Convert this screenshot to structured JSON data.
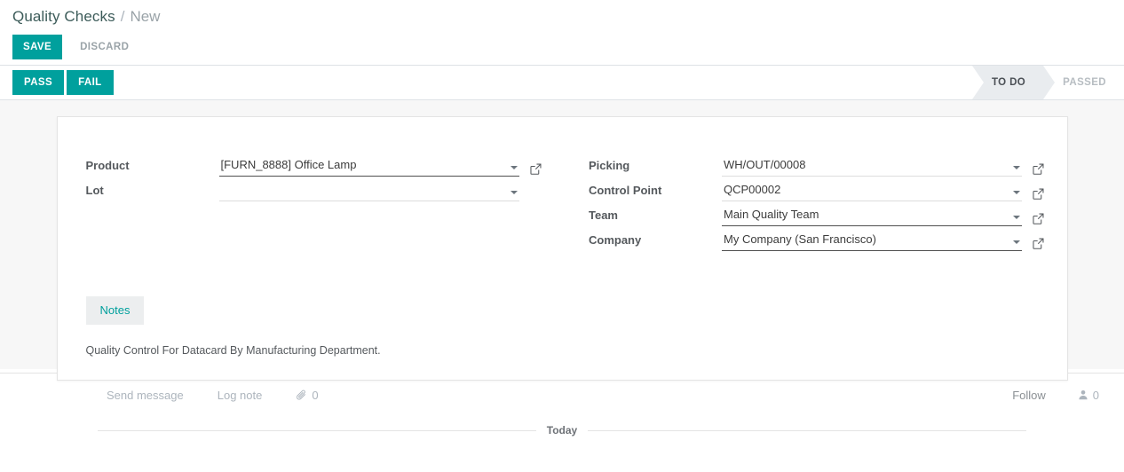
{
  "breadcrumb": {
    "root": "Quality Checks",
    "separator": "/",
    "current": "New"
  },
  "action_bar": {
    "save_label": "SAVE",
    "discard_label": "DISCARD"
  },
  "statusbar_row": {
    "pass_label": "PASS",
    "fail_label": "FAIL",
    "stages": [
      {
        "label": "TO DO",
        "active": true
      },
      {
        "label": "PASSED",
        "active": false
      }
    ]
  },
  "form": {
    "left_fields": [
      {
        "label": "Product",
        "value": "[FURN_8888] Office Lamp",
        "placeholder": "",
        "focused": true,
        "has_caret": true,
        "has_external_link": true,
        "external_link_icon": "external-link-icon"
      },
      {
        "label": "Lot",
        "value": "",
        "placeholder": "",
        "focused": false,
        "has_caret": true,
        "has_external_link": false,
        "external_link_icon": "external-link-icon"
      }
    ],
    "right_fields": [
      {
        "label": "Picking",
        "value": "WH/OUT/00008",
        "placeholder": "",
        "focused": false,
        "has_caret": true,
        "has_external_link": true,
        "external_link_icon": "external-link-icon"
      },
      {
        "label": "Control Point",
        "value": "QCP00002",
        "placeholder": "",
        "focused": false,
        "has_caret": true,
        "has_external_link": true,
        "external_link_icon": "external-link-icon"
      },
      {
        "label": "Team",
        "value": "Main Quality Team",
        "placeholder": "",
        "focused": true,
        "has_caret": true,
        "has_external_link": true,
        "external_link_icon": "external-link-icon"
      },
      {
        "label": "Company",
        "value": "My Company (San Francisco)",
        "placeholder": "",
        "focused": true,
        "has_caret": true,
        "has_external_link": true,
        "external_link_icon": "external-link-icon"
      }
    ]
  },
  "notebook": {
    "tabs": [
      {
        "label": "Notes",
        "active": true
      }
    ],
    "note_text": "Quality Control For Datacard By Manufacturing Department."
  },
  "chatter": {
    "send_message_label": "Send message",
    "log_note_label": "Log note",
    "attachment_icon": "paperclip-icon",
    "attachment_count": "0",
    "follow_label": "Follow",
    "followers_icon": "user-icon",
    "followers_count": "0",
    "date_divider": "Today"
  },
  "colors": {
    "accent": "#00a09d",
    "page_bg": "#f7f7f7",
    "sheet_bg": "#ffffff",
    "status_active_bg": "#e9ecef",
    "label_text": "#55595d",
    "muted_text": "#adb5bd"
  }
}
